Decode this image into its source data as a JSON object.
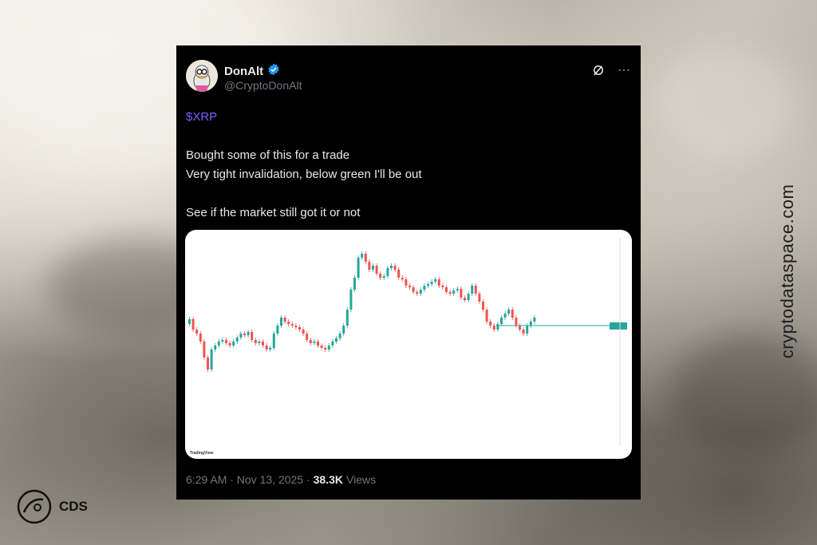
{
  "tweet": {
    "display_name": "DonAlt",
    "handle": "@CryptoDonAlt",
    "cashtag": "$XRP",
    "body": "Bought some of this for a trade\nVery tight invalidation, below green I'll be out\n\nSee if the market still got it or not",
    "timestamp": "6:29 AM · Nov 13, 2025 ·",
    "views_count": "38.3K",
    "views_label": "Views",
    "verified": true,
    "icons": [
      "grok-icon",
      "more-icon",
      "verified-badge-icon"
    ]
  },
  "chart_image": {
    "watermark": "TradingView"
  },
  "side_text": "cryptodataspace.com",
  "logo": {
    "name": "CDS"
  },
  "colors": {
    "card_bg": "#000000",
    "cashtag": "#7b5cff",
    "verified": "#1d9bf0",
    "candle_up": "#26a69a",
    "candle_down": "#ef5350"
  }
}
